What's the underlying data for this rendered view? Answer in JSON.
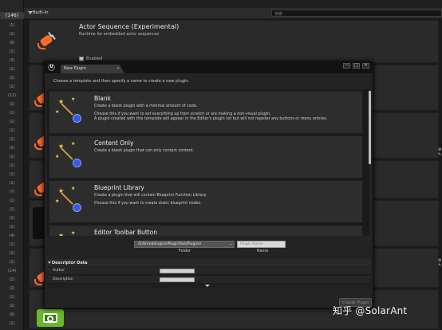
{
  "sidebar": {
    "counts": [
      "(146)",
      "(1)",
      "(1)",
      "(6)",
      "(1)",
      "(3)",
      "(1)",
      "(2)",
      "(1)",
      "(12)",
      "(2)",
      "(1)",
      "(1)",
      "(1)",
      "(1)",
      "(5)",
      "(1)",
      "(1)",
      "(1)",
      "(1)",
      "(7)",
      "(1)",
      "(1)",
      "(1)",
      "(1)",
      "(4)",
      "(1)",
      "(1)",
      "(1)",
      "(14)",
      "(2)",
      "(2)",
      "(1)",
      "(1)",
      "(9)",
      "(1)",
      "(5)",
      "(1)"
    ]
  },
  "topbar": {
    "category": "Built-In",
    "search_placeholder": "搜索"
  },
  "background_plugin": {
    "name": "Actor Sequence (Experimental)",
    "description": "Runtime for embedded actor sequences",
    "enabled_label": "Enabled"
  },
  "modal": {
    "tab_title": "New Plugin",
    "tab_close": "×",
    "window_buttons": [
      "—",
      "□",
      "✕"
    ],
    "instruction": "Choose a template and then specify a name to create a new plugin.",
    "templates": [
      {
        "name": "Blank",
        "lines": [
          "Create a blank plugin with a minimal amount of code.",
          "",
          "Choose this if you want to set everything up from scratch or are making a non-visual plugin.",
          "A plugin created with this template will appear in the Editor's plugin list but will not register any buttons or menu entries."
        ]
      },
      {
        "name": "Content Only",
        "lines": [
          "Create a blank plugin that can only contain content."
        ]
      },
      {
        "name": "Blueprint Library",
        "lines": [
          "Create a plugin that will contain Blueprint Function Library.",
          "",
          "Choose this if you want to create static blueprint nodes."
        ]
      },
      {
        "name": "Editor Toolbar Button",
        "lines": []
      }
    ],
    "folder_value": "/E/UnrealEngine/PluginTest/Plugins\\",
    "browse_label": "...",
    "name_placeholder": "Plugin Name",
    "folder_label": "Folder",
    "name_label": "Name",
    "descriptor": {
      "header": "Descriptor Data",
      "rows": [
        {
          "label": "Author"
        },
        {
          "label": "Description"
        }
      ]
    },
    "create_button": "Create Plugin"
  },
  "watermark": "知乎 @SolarAnt",
  "side_icons": [
    "⚙ ✎",
    "⚙ ✎"
  ],
  "colors": {
    "plugin_orange": "#ff6a2a",
    "camera_green": "#6ab82c"
  }
}
